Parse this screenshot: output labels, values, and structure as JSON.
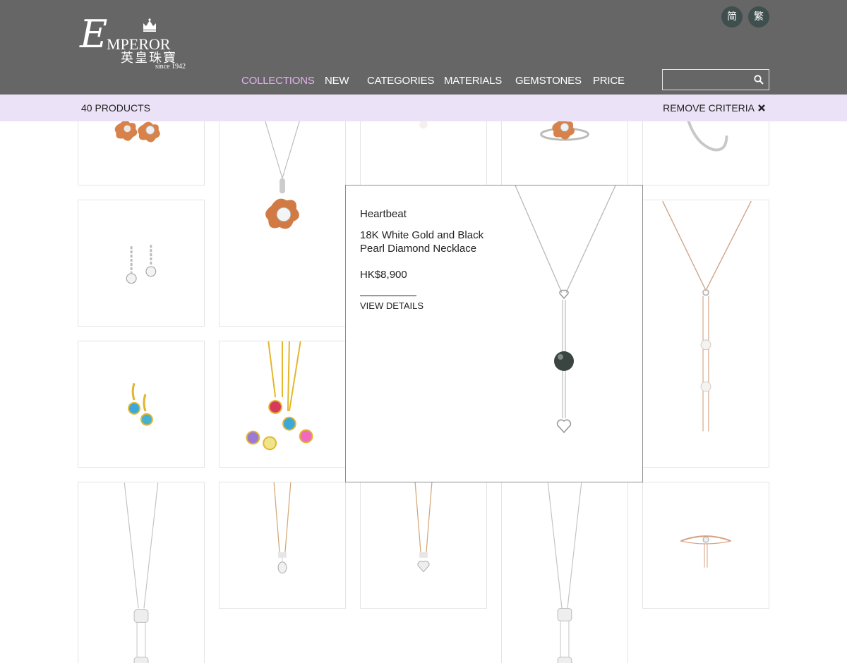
{
  "header": {
    "logo": {
      "word": "MPEROR",
      "initial": "E",
      "chinese": "英皇珠寶",
      "since": "since 1942"
    },
    "languages": [
      "简",
      "繁"
    ],
    "nav": [
      "COLLECTIONS",
      "NEW",
      "CATEGORIES",
      "MATERIALS",
      "GEMSTONES",
      "PRICE"
    ],
    "active_nav": "COLLECTIONS",
    "search": {
      "value": "",
      "placeholder": ""
    }
  },
  "filterbar": {
    "count": "40 PRODUCTS",
    "remove_label": "REMOVE CRITERIA"
  },
  "popup": {
    "collection": "Heartbeat",
    "name": "18K White Gold and Black Pearl Diamond Necklace",
    "price": "HK$8,900",
    "view_label": "VIEW DETAILS"
  },
  "colors": {
    "header_bg": "#666666",
    "nav_active": "#e3b2f0",
    "filterbar_bg": "#ece2f7",
    "lang_bg": "#3f4f4d"
  }
}
